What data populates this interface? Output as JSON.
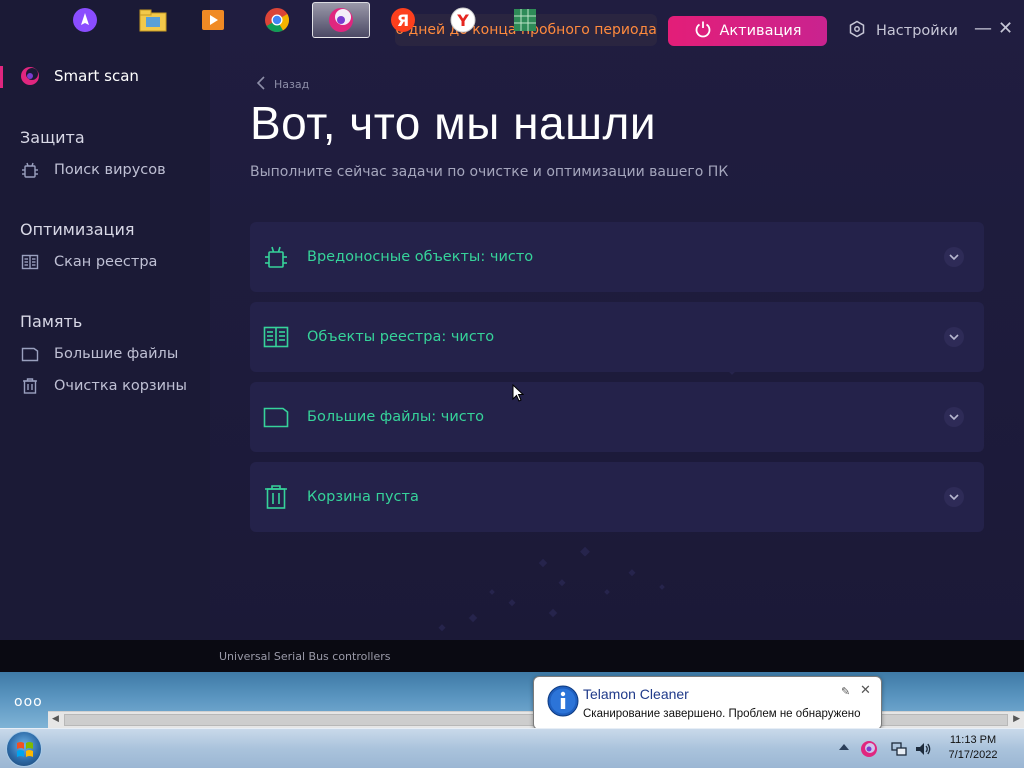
{
  "app": {
    "trial_text": "6 дней до конца пробного периода",
    "activate_label": "Активация",
    "settings_label": "Настройки",
    "minimize_glyph": "—",
    "close_glyph": "✕"
  },
  "sidebar": {
    "smart_scan": "Smart scan",
    "sections": [
      {
        "title": "Защита",
        "items": [
          {
            "label": "Поиск вирусов",
            "icon": "bug-icon"
          }
        ]
      },
      {
        "title": "Оптимизация",
        "items": [
          {
            "label": "Скан реестра",
            "icon": "registry-book-icon"
          }
        ]
      },
      {
        "title": "Память",
        "items": [
          {
            "label": "Большие файлы",
            "icon": "folder-icon"
          },
          {
            "label": "Очистка корзины",
            "icon": "trash-icon"
          }
        ]
      }
    ]
  },
  "main": {
    "back_label": "Назад",
    "title": "Вот, что мы нашли",
    "subtitle": "Выполните сейчас задачи по очистке и оптимизации вашего ПК",
    "results": [
      {
        "label": "Вредоносные объекты: чисто",
        "icon": "bug-icon"
      },
      {
        "label": "Объекты реестра: чисто",
        "icon": "registry-book-icon"
      },
      {
        "label": "Большие файлы: чисто",
        "icon": "folder-icon"
      },
      {
        "label": "Корзина пуста",
        "icon": "trash-icon"
      }
    ]
  },
  "background": {
    "usb_text": "Universal Serial Bus controllers",
    "dots": "ooo"
  },
  "notification": {
    "title": "Telamon Cleaner",
    "message": "Сканирование завершено. Проблем не обнаружено"
  },
  "taskbar": {
    "time": "11:13 PM",
    "date": "7/17/2022",
    "apps": [
      "alice-icon",
      "file-explorer-icon",
      "media-player-icon",
      "chrome-icon",
      "telamon-cleaner-icon",
      "yandex-icon",
      "yandex-browser-icon",
      "spreadsheet-icon"
    ]
  },
  "colors": {
    "accent_pink": "#e31e78",
    "trial_orange": "#ff8a3d",
    "clean_green": "#36d39a",
    "panel_bg": "#1e1c3a"
  }
}
